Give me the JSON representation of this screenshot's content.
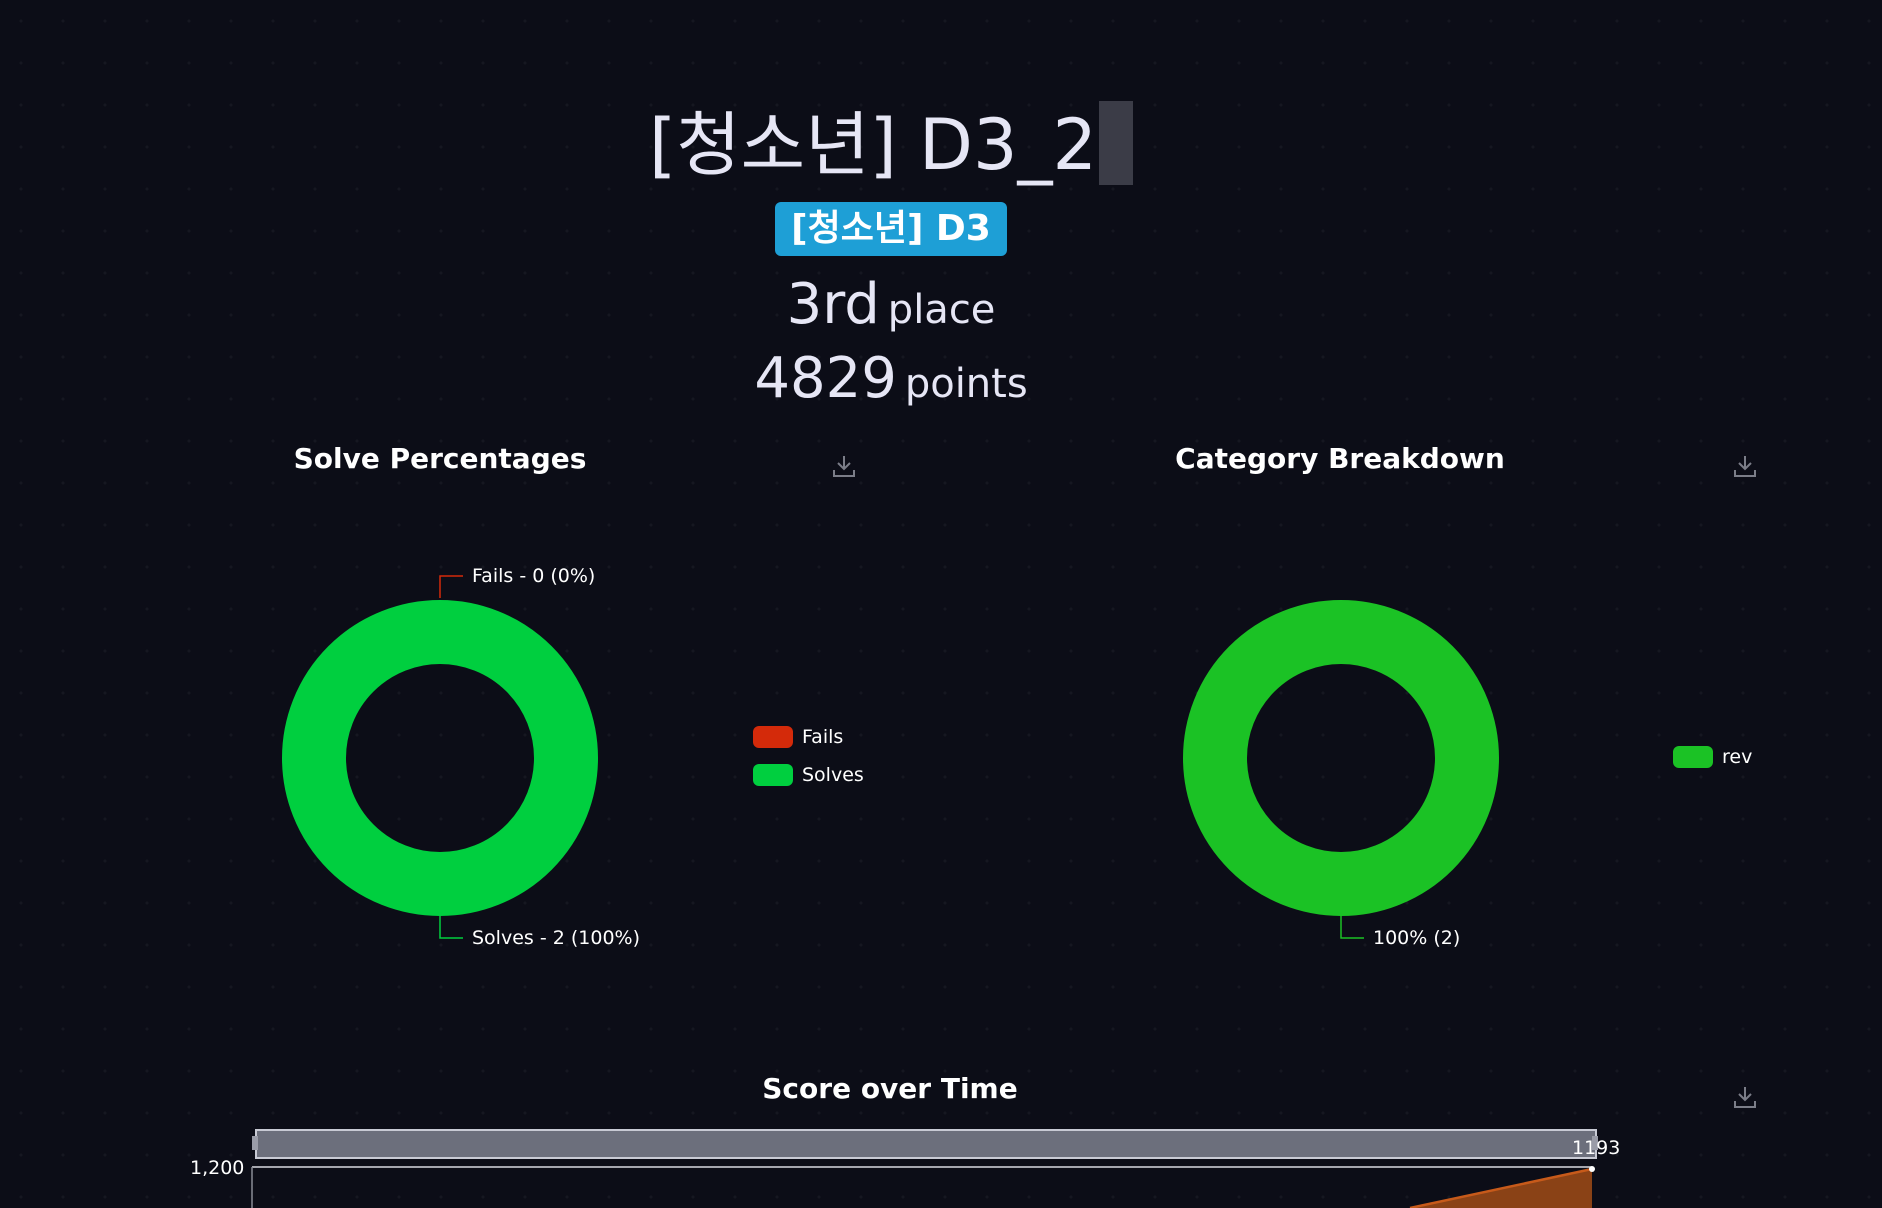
{
  "team": {
    "name": "[청소년] D3_2",
    "affiliation": "[청소년] D3",
    "place_value": "3rd",
    "place_unit": "place",
    "points_value": "4829",
    "points_unit": "points"
  },
  "solve_chart": {
    "title": "Solve Percentages",
    "download_icon": "download-icon",
    "labels": {
      "fails": "Fails - 0 (0%)",
      "solves": "Solves - 2 (100%)"
    },
    "legend": [
      {
        "label": "Fails",
        "color": "#d42a0a"
      },
      {
        "label": "Solves",
        "color": "#00cf3f"
      }
    ]
  },
  "category_chart": {
    "title": "Category Breakdown",
    "download_icon": "download-icon",
    "slice_label": "100% (2)",
    "legend": [
      {
        "label": "rev",
        "color": "#1bc225"
      }
    ]
  },
  "score_chart": {
    "title": "Score over Time",
    "download_icon": "download-icon",
    "y_tick": "1,200",
    "end_value": "1193",
    "line_color": "#c75a1a",
    "area_color": "#8a4216"
  },
  "chart_data": [
    {
      "type": "pie",
      "title": "Solve Percentages",
      "categories": [
        "Fails",
        "Solves"
      ],
      "values": [
        0,
        2
      ],
      "percentages": [
        0,
        100
      ],
      "colors": [
        "#d42a0a",
        "#00cf3f"
      ],
      "legend": "right"
    },
    {
      "type": "pie",
      "title": "Category Breakdown",
      "categories": [
        "rev"
      ],
      "values": [
        2
      ],
      "percentages": [
        100
      ],
      "colors": [
        "#1bc225"
      ],
      "legend": "right"
    },
    {
      "type": "area",
      "title": "Score over Time",
      "y_ticks": [
        1200
      ],
      "end_value": 1193,
      "ylim_top": 1200
    }
  ]
}
